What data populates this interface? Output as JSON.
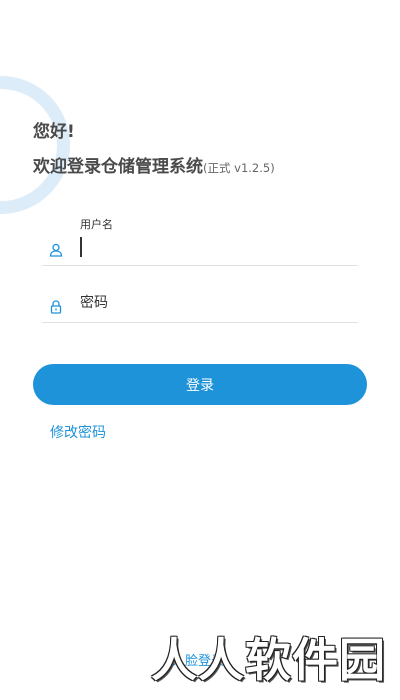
{
  "header": {
    "greeting": "您好!",
    "welcome": "欢迎登录仓储管理系统",
    "version": "(正式 v1.2.5)"
  },
  "form": {
    "username": {
      "label": "用户名",
      "value": "",
      "icon": "user-icon"
    },
    "password": {
      "placeholder": "密码",
      "icon": "lock-icon"
    }
  },
  "actions": {
    "login_label": "登录",
    "change_password_label": "修改密码",
    "face_login_label": "人脸登录"
  },
  "watermark": "人人软件园",
  "colors": {
    "accent": "#1f93da",
    "ring": "#dcecf9",
    "text": "#4a4a4a"
  }
}
